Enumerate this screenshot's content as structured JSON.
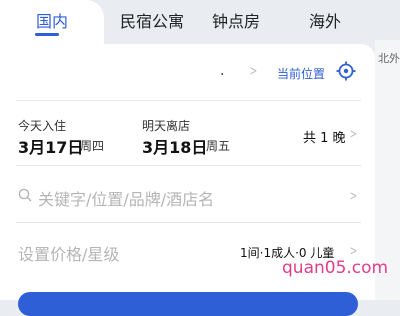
{
  "tabs": [
    {
      "label": "国内",
      "active": true
    },
    {
      "label": "民宿公寓"
    },
    {
      "label": "钟点房"
    },
    {
      "label": "海外"
    }
  ],
  "side_hint": "北外",
  "destination": {
    "value": ".",
    "location_label": "当前位置",
    "icon": "locate-icon"
  },
  "dates": {
    "checkin_label": "今天入住",
    "checkin_date": "3月17日",
    "checkin_weekday": "周四",
    "checkout_label": "明天离店",
    "checkout_date": "3月18日",
    "checkout_weekday": "周五",
    "nights": "共 1 晚"
  },
  "search": {
    "placeholder": "关键字/位置/品牌/酒店名",
    "icon": "search-icon"
  },
  "filters": {
    "price_placeholder": "设置价格/星级",
    "guests": "1间·1成人·0 儿童"
  },
  "watermark": "quan05.com",
  "colors": {
    "accent": "#2f5fd6",
    "watermark": "#e23d8a"
  }
}
